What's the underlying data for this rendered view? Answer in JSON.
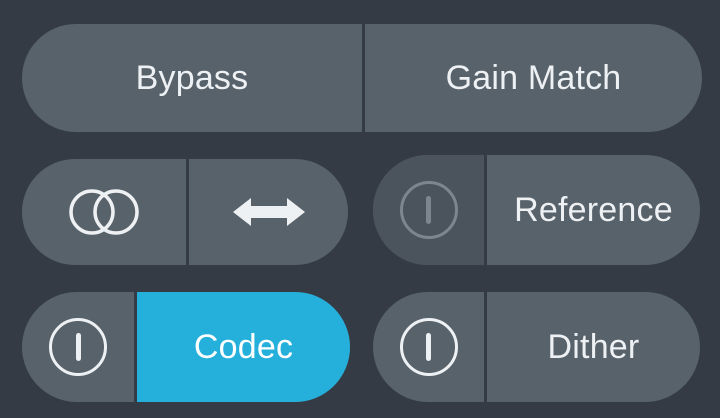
{
  "row1": {
    "bypass_label": "Bypass",
    "gain_match_label": "Gain Match"
  },
  "row2": {
    "left": {
      "overlap_icon": "overlap-circles-icon",
      "swap_icon": "left-right-arrow-icon"
    },
    "reference": {
      "power_icon": "power-icon",
      "label": "Reference",
      "power_state": "off"
    }
  },
  "row3": {
    "codec": {
      "power_icon": "power-icon",
      "label": "Codec",
      "active": true
    },
    "dither": {
      "power_icon": "power-icon",
      "label": "Dither",
      "power_state": "off"
    }
  },
  "colors": {
    "background": "#343b44",
    "button": "#58626b",
    "button_dark": "#4b545d",
    "accent": "#25b0dc",
    "text": "#eef1f3"
  }
}
